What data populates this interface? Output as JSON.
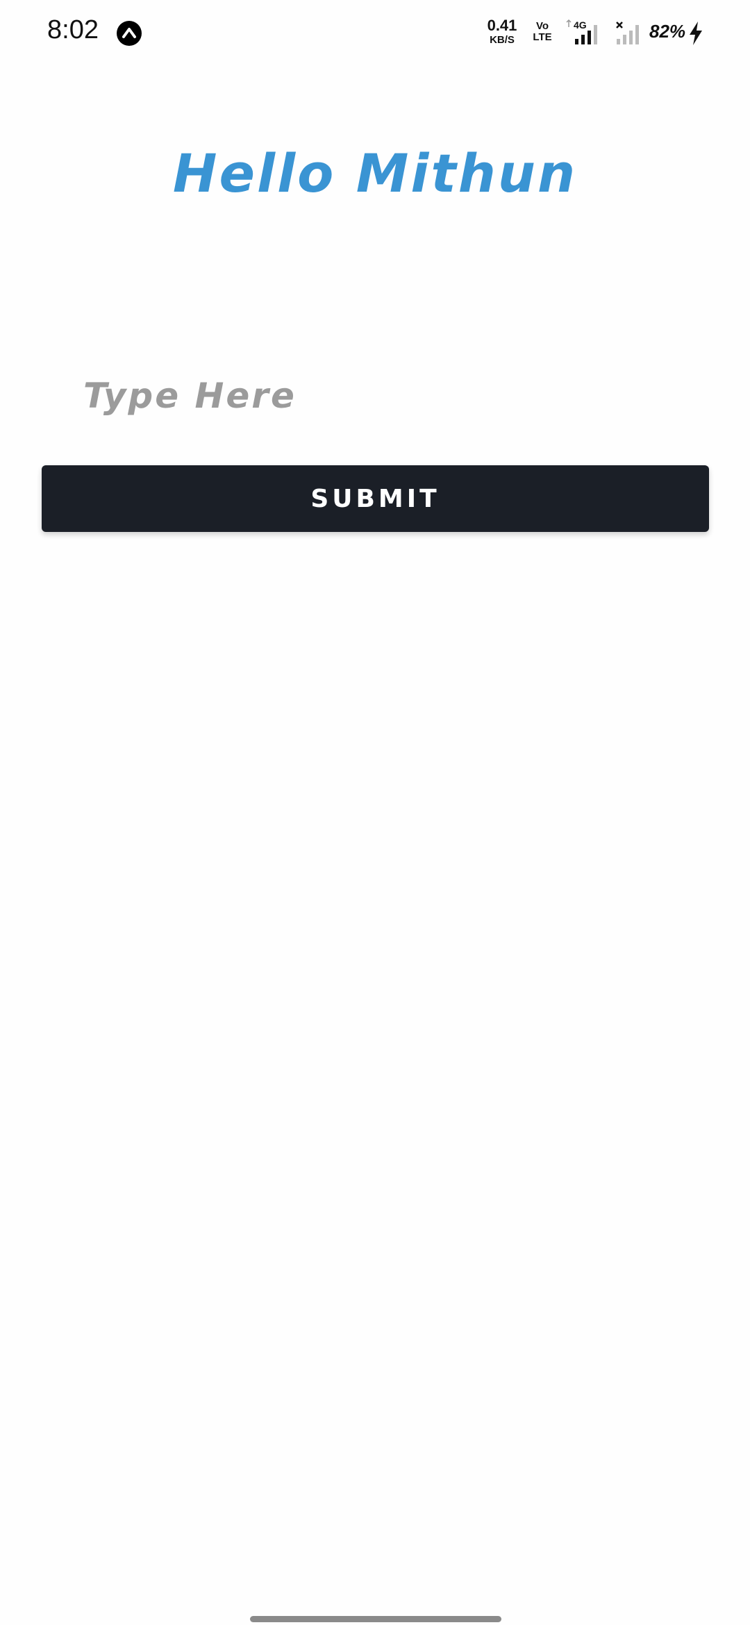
{
  "status_bar": {
    "time": "8:02",
    "app_icon": "caret-up-icon",
    "net_speed_value": "0.41",
    "net_speed_unit": "KB/S",
    "volte_line1": "Vo",
    "volte_line2": "LTE",
    "network_type": "4G",
    "battery_percent": "82%",
    "charging_icon": "lightning-bolt-icon"
  },
  "main": {
    "greeting": "Hello Mithun",
    "input_placeholder": "Type Here",
    "input_value": "",
    "submit_label": "SUBMIT"
  },
  "colors": {
    "greeting": "#3a94d3",
    "button_bg": "#1b1f27",
    "placeholder": "#9b9b9b",
    "background": "#fefefe"
  }
}
